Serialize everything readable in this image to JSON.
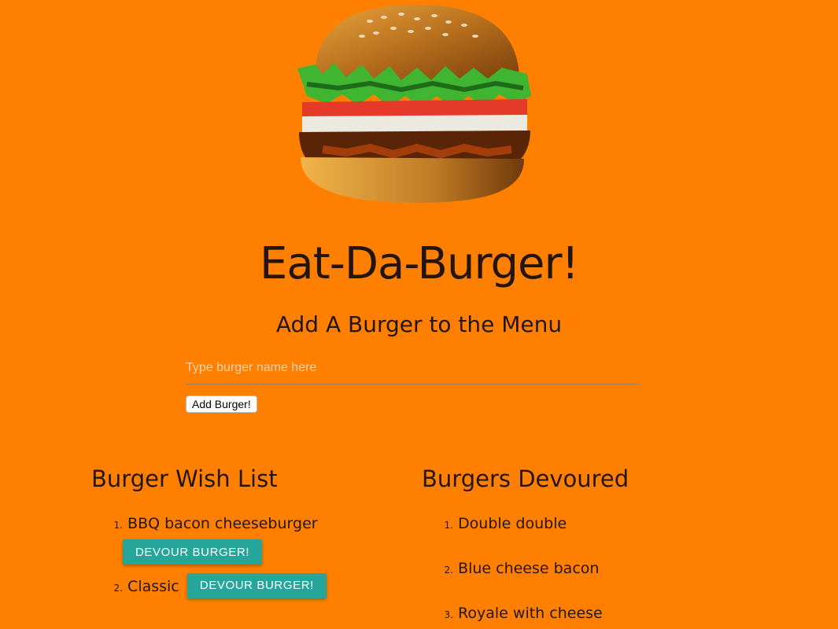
{
  "header": {
    "title": "Eat-Da-Burger!",
    "subtitle": "Add A Burger to the Menu"
  },
  "form": {
    "placeholder": "Type burger name here",
    "value": "",
    "submit_label": "Add Burger!"
  },
  "wish_list": {
    "title": "Burger Wish List",
    "button_label": "DEVOUR BURGER!",
    "items": [
      {
        "num": "1.",
        "name": "BBQ bacon cheeseburger"
      },
      {
        "num": "2.",
        "name": "Classic"
      }
    ]
  },
  "devoured": {
    "title": "Burgers Devoured",
    "items": [
      {
        "num": "1.",
        "name": "Double double"
      },
      {
        "num": "2.",
        "name": "Blue cheese bacon"
      },
      {
        "num": "3.",
        "name": "Royale with cheese"
      }
    ]
  },
  "colors": {
    "background": "#ff8000",
    "button": "#26a69a",
    "text": "#24150a"
  }
}
